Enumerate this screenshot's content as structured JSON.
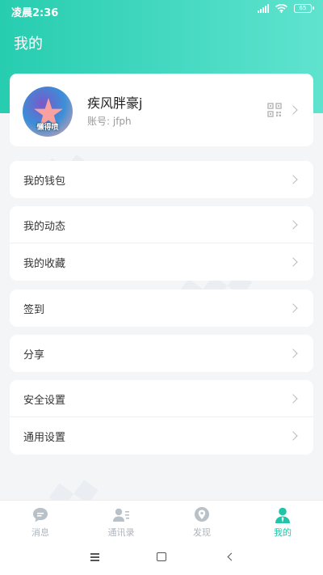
{
  "status_bar": {
    "time": "凌晨2:36",
    "battery": "65"
  },
  "header": {
    "title": "我的"
  },
  "profile": {
    "name": "疾风胖豪j",
    "account": "账号: jfph",
    "avatar_caption": "懒得喷"
  },
  "menu_groups": [
    {
      "items": [
        {
          "label": "我的钱包"
        }
      ]
    },
    {
      "items": [
        {
          "label": "我的动态"
        },
        {
          "label": "我的收藏"
        }
      ]
    },
    {
      "items": [
        {
          "label": "签到"
        }
      ]
    },
    {
      "items": [
        {
          "label": "分享"
        }
      ]
    },
    {
      "items": [
        {
          "label": "安全设置"
        },
        {
          "label": "通用设置"
        }
      ]
    }
  ],
  "tabbar": {
    "tabs": [
      {
        "label": "消息",
        "icon": "chat-icon"
      },
      {
        "label": "通讯录",
        "icon": "contacts-icon"
      },
      {
        "label": "发现",
        "icon": "location-icon"
      },
      {
        "label": "我的",
        "icon": "user-icon"
      }
    ],
    "active_index": 3
  },
  "colors": {
    "accent": "#20c5a8",
    "header_gradient_start": "#27cdb0",
    "header_gradient_end": "#5fe3cf",
    "inactive_tab": "#aeb5bd"
  }
}
